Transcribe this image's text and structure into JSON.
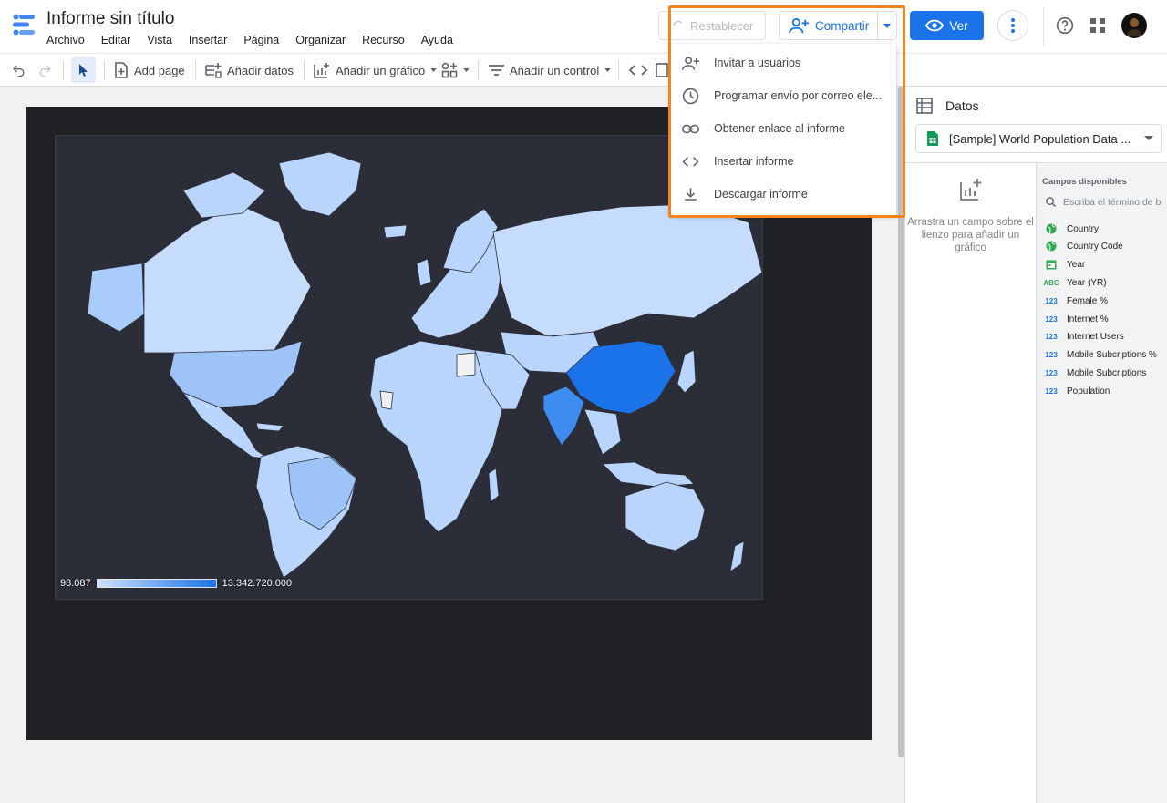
{
  "app": {
    "title": "Informe sin título",
    "menu": [
      "Archivo",
      "Editar",
      "Vista",
      "Insertar",
      "Página",
      "Organizar",
      "Recurso",
      "Ayuda"
    ]
  },
  "header": {
    "reset_label": "Restablecer",
    "share_label": "Compartir",
    "view_label": "Ver"
  },
  "toolbar": {
    "add_page": "Add page",
    "add_data": "Añadir datos",
    "add_chart": "Añadir un gráfico",
    "add_control": "Añadir un control"
  },
  "share_menu": {
    "items": [
      {
        "label": "Invitar a usuarios",
        "icon": "person-add-icon"
      },
      {
        "label": "Programar envío por correo ele...",
        "icon": "clock-icon"
      },
      {
        "label": "Obtener enlace al informe",
        "icon": "link-icon"
      },
      {
        "label": "Insertar informe",
        "icon": "code-icon"
      },
      {
        "label": "Descargar informe",
        "icon": "download-icon"
      }
    ]
  },
  "map": {
    "legend_min": "98.087",
    "legend_max": "13.342.720.000",
    "colors": {
      "low": "#cfe2ff",
      "high": "#1a73e8",
      "background": "#2b2d38"
    }
  },
  "panel": {
    "title": "Datos",
    "datasource": "[Sample] World Population Data ...",
    "drop_hint": "Arrastra un campo sobre el lienzo para añadir un gráfico",
    "fields_title": "Campos disponibles",
    "search_placeholder": "Escriba el término de b",
    "fields": [
      {
        "name": "Country",
        "type": "geo"
      },
      {
        "name": "Country Code",
        "type": "geo"
      },
      {
        "name": "Year",
        "type": "date"
      },
      {
        "name": "Year (YR)",
        "type": "text"
      },
      {
        "name": "Female %",
        "type": "number"
      },
      {
        "name": "Internet %",
        "type": "number"
      },
      {
        "name": "Internet Users",
        "type": "number"
      },
      {
        "name": "Mobile Subcriptions %",
        "type": "number"
      },
      {
        "name": "Mobile Subcriptions",
        "type": "number"
      },
      {
        "name": "Population",
        "type": "number"
      }
    ],
    "type_labels": {
      "text": "ABC",
      "number": "123"
    }
  }
}
